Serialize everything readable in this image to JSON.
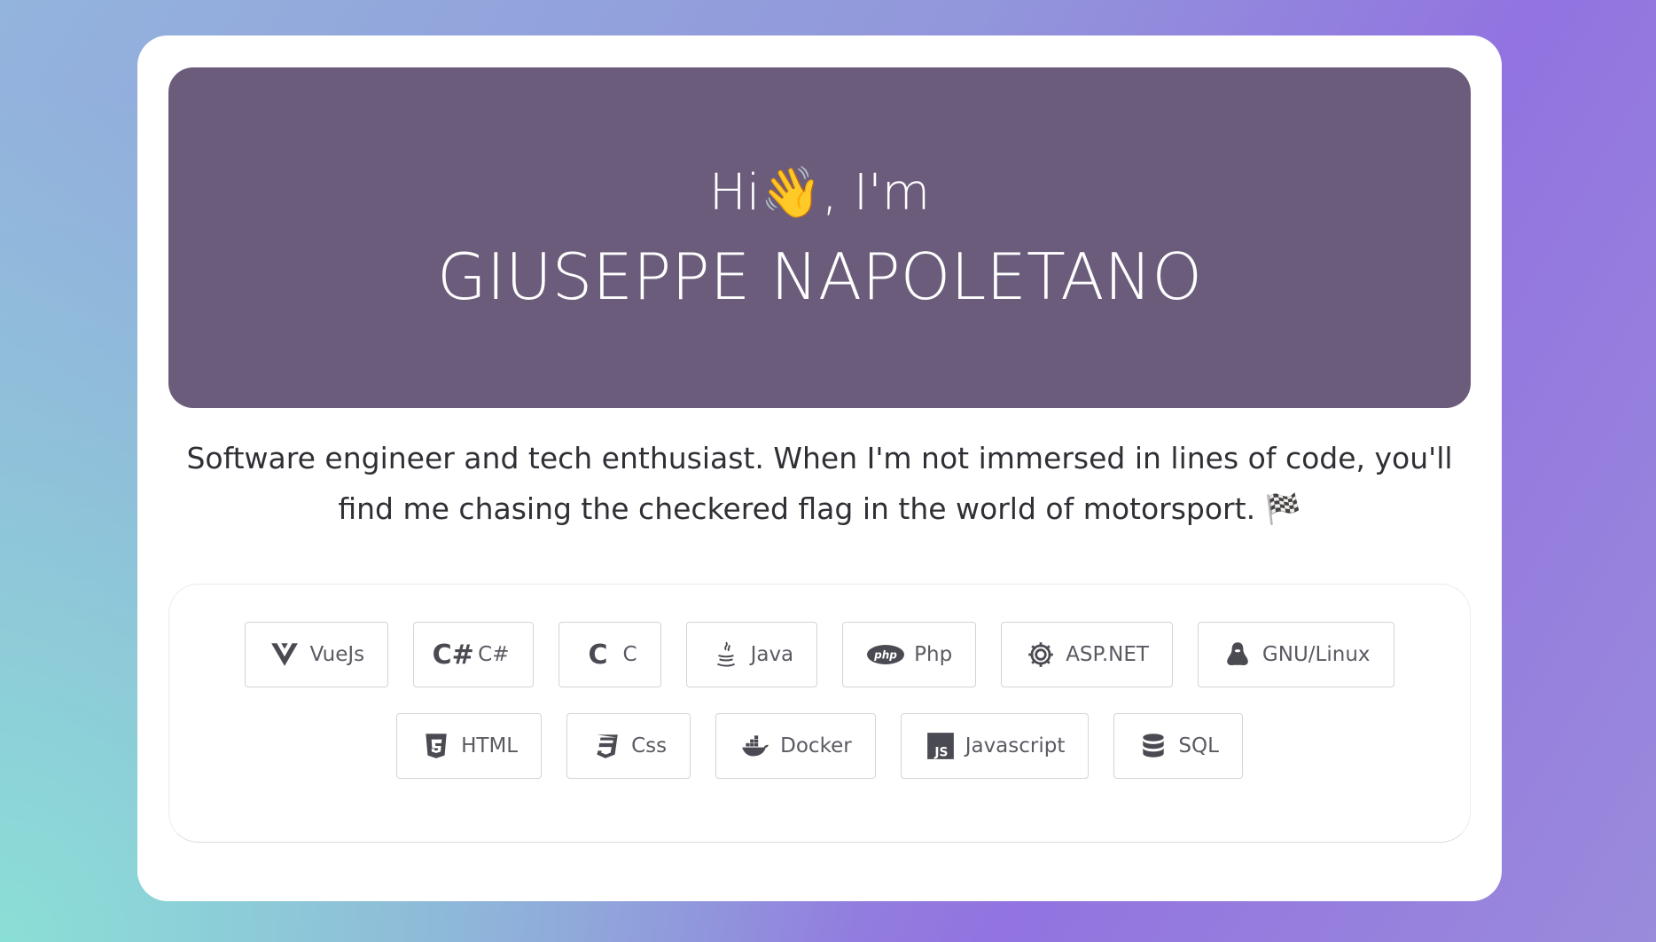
{
  "hero": {
    "greeting_prefix": "Hi",
    "greeting_emoji": "👋",
    "greeting_suffix": ", I'm",
    "name": "GIUSEPPE NAPOLETANO"
  },
  "bio": {
    "text": "Software engineer and tech enthusiast. When I'm not immersed in lines of code, you'll find me chasing the checkered flag in the world of motorsport.",
    "emoji": "🏁"
  },
  "skills": [
    {
      "label": "VueJs",
      "icon": "vue-icon"
    },
    {
      "label": "C#",
      "icon": "csharp-icon"
    },
    {
      "label": "C",
      "icon": "c-icon"
    },
    {
      "label": "Java",
      "icon": "java-icon"
    },
    {
      "label": "Php",
      "icon": "php-icon"
    },
    {
      "label": "ASP.NET",
      "icon": "gear-icon"
    },
    {
      "label": "GNU/Linux",
      "icon": "linux-icon"
    },
    {
      "label": "HTML",
      "icon": "html5-icon"
    },
    {
      "label": "Css",
      "icon": "css3-icon"
    },
    {
      "label": "Docker",
      "icon": "docker-icon"
    },
    {
      "label": "Javascript",
      "icon": "js-icon"
    },
    {
      "label": "SQL",
      "icon": "database-icon"
    }
  ],
  "colors": {
    "hero_bg": "#6b5c7b",
    "card_bg": "#ffffff",
    "text": "#2f2f35"
  }
}
